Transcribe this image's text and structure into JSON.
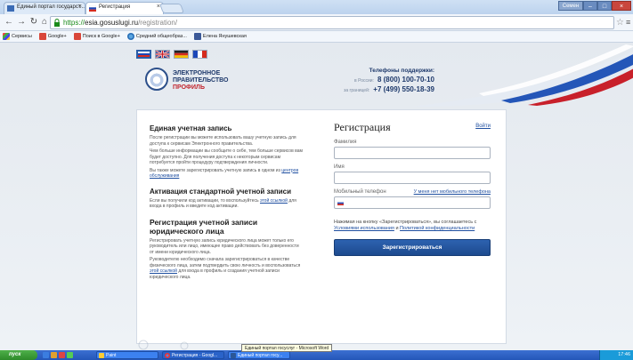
{
  "browser": {
    "tabs": [
      {
        "label": "Единый портал государст..."
      },
      {
        "label": "Регистрация"
      }
    ],
    "window_user": "Семен",
    "url_scheme": "https://",
    "url_host": "esia.gosuslugi.ru",
    "url_path": "/registration/",
    "bookmarks": [
      {
        "label": "Сервисы"
      },
      {
        "label": "Google+"
      },
      {
        "label": "Поиск в Google+"
      },
      {
        "label": "Средний общеобраз..."
      },
      {
        "label": "Елена Янушевская"
      }
    ]
  },
  "header": {
    "logo_line1": "ЭЛЕКТРОННОЕ",
    "logo_line2": "ПРАВИТЕЛЬСТВО",
    "logo_line3": "ПРОФИЛЬ",
    "phones_title": "Телефоны поддержки:",
    "phone_russia_label": "в России:",
    "phone_russia": "8 (800) 100-70-10",
    "phone_abroad_label": "за границей:",
    "phone_abroad": "+7 (499) 550-18-39"
  },
  "left": {
    "s1_title": "Единая учетная запись",
    "s1_p1": "После регистрации вы можете использовать вашу учетную запись для доступа к сервисам Электронного правительства.",
    "s1_p2": "Чем больше информации вы сообщите о себе, тем больше сервисов вам будет доступно. Для получения доступа к некоторым сервисам потребуется пройти процедуру подтверждения личности.",
    "s1_p3": "Вы также можете зарегистрировать учетную запись в одном из",
    "s1_link": "центров обслуживания",
    "s2_title": "Активация стандартной учетной записи",
    "s2_p1": "Если вы получили код активации, то воспользуйтесь",
    "s2_link": "этой ссылкой",
    "s2_p1b": "для входа в профиль и введите код активации.",
    "s3_title": "Регистрация учетной записи юридического лица",
    "s3_p1": "Регистрировать учетную запись юридического лица может только его руководитель или лицо, имеющее право действовать без доверенности от имени юридического лица.",
    "s3_p2": "Руководителю необходимо сначала зарегистрироваться в качестве физического лица, затем подтвердить свою личность и воспользоваться",
    "s3_link": "этой ссылкой",
    "s3_p2b": "для входа в профиль и создания учетной записи юридического лица."
  },
  "form": {
    "title": "Регистрация",
    "login_link": "Войти",
    "surname_label": "Фамилия",
    "name_label": "Имя",
    "phone_label": "Мобильный телефон",
    "no_mobile_link": "У меня нет мобильного телефона",
    "agree_text": "Нажимая на кнопку «Зарегистрироваться», вы соглашаетесь с",
    "terms_link": "Условиями использования",
    "and": "и",
    "privacy_link": "Политикой конфиденциальности",
    "submit": "Зарегистрироваться"
  },
  "tooltip": "Единый портал госуслуг - Microsoft Word",
  "taskbar": {
    "start": "пуск",
    "tasks": [
      {
        "label": "Paint"
      },
      {
        "label": "Регистрация - Googl..."
      },
      {
        "label": "Единый портал госу..."
      }
    ],
    "clock": "17:46"
  },
  "colors": {
    "accent": "#1f4fa0",
    "button": "#2456a0",
    "brand_red": "#c2262e"
  }
}
